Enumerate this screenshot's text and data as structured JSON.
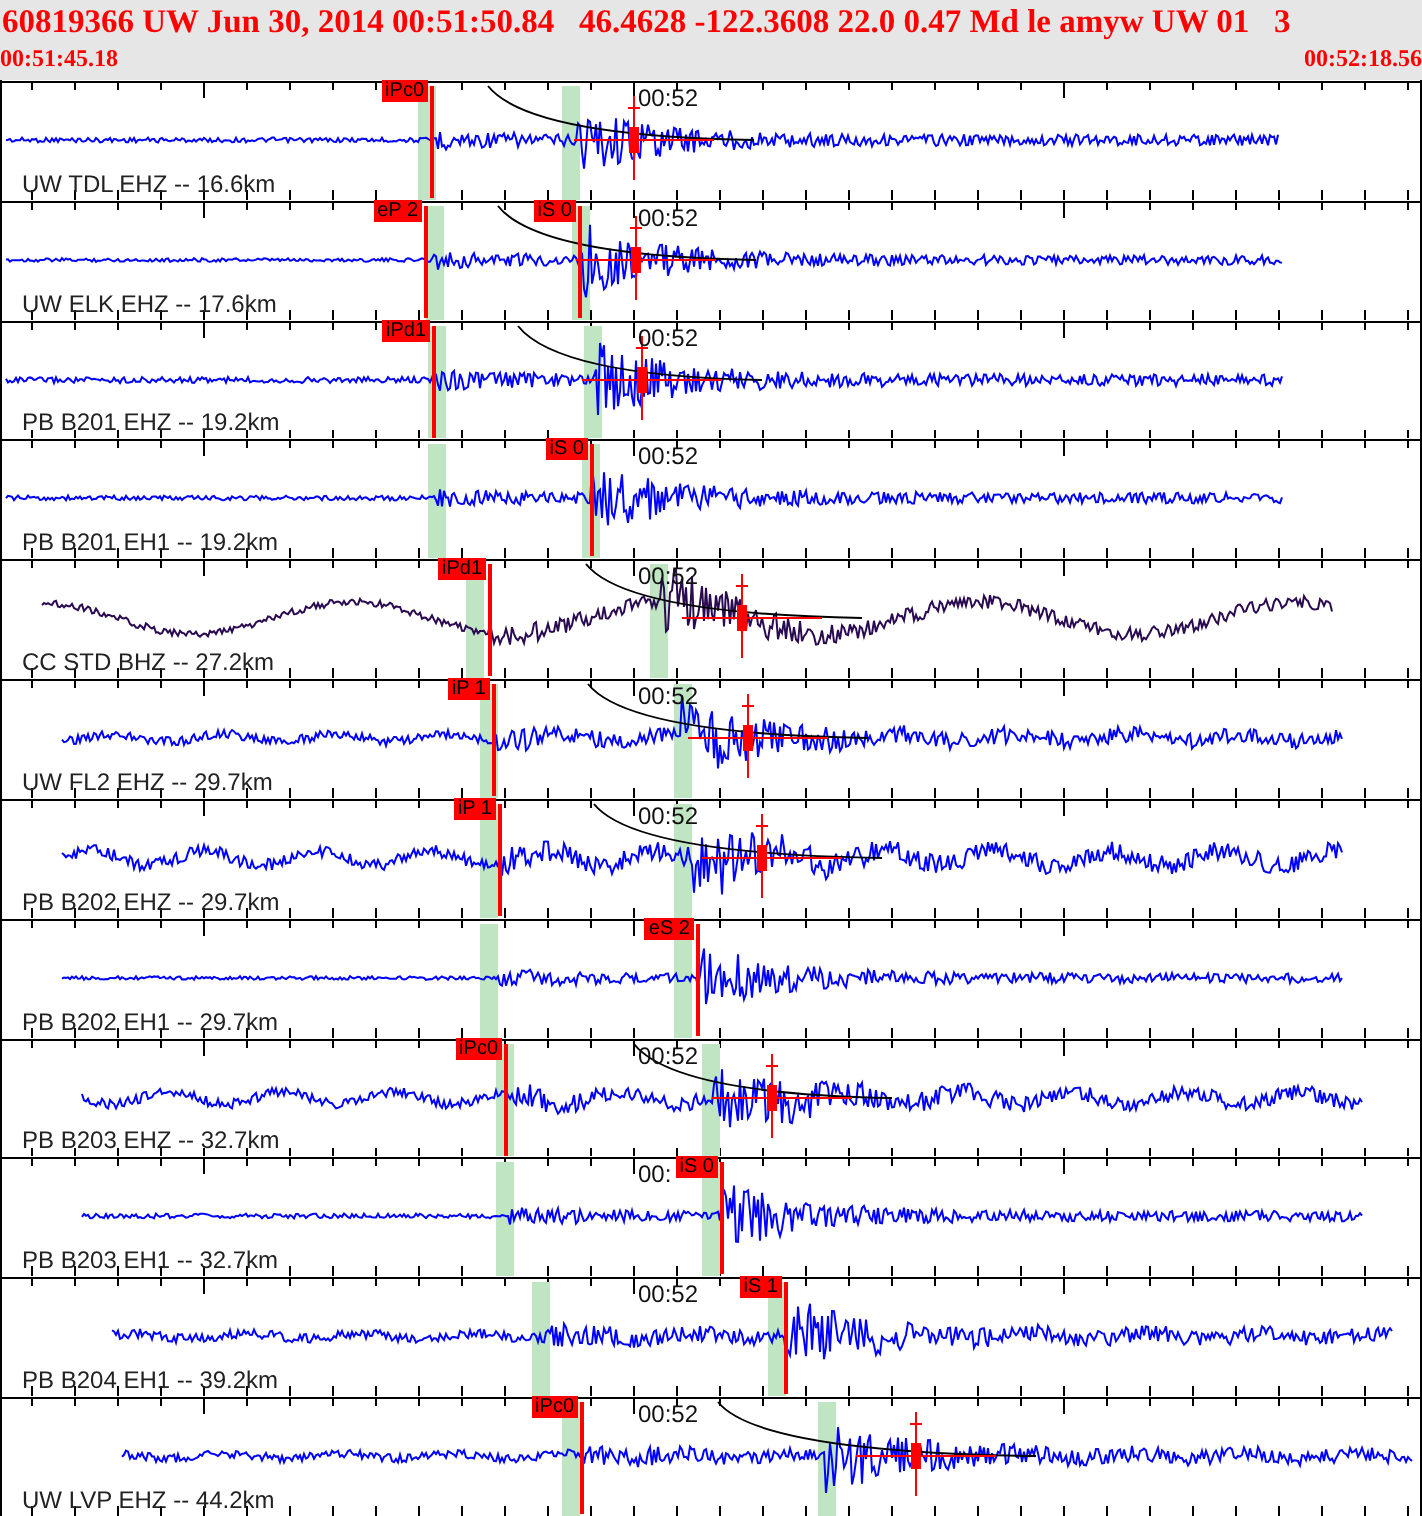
{
  "header": {
    "title": "60819366 UW Jun 30, 2014 00:51:50.84   46.4628 -122.3608 22.0 0.47 Md le amyw UW 01   3",
    "start_time": "00:51:45.18",
    "end_time": "00:52:18.56"
  },
  "traces": [
    {
      "label": "UW TDL EHZ -- 16.6km",
      "color": "#0000ff",
      "time_mark": "00:52",
      "picks": [
        {
          "label": "iPc0"
        }
      ]
    },
    {
      "label": "UW ELK EHZ -- 17.6km",
      "color": "#0000ff",
      "time_mark": "00:52",
      "picks": [
        {
          "label": "eP 2"
        },
        {
          "label": "iS 0"
        }
      ]
    },
    {
      "label": "PB B201 EHZ -- 19.2km",
      "color": "#0000ff",
      "time_mark": "00:52",
      "picks": [
        {
          "label": "iPd1"
        }
      ]
    },
    {
      "label": "PB B201 EH1 -- 19.2km",
      "color": "#0000ff",
      "time_mark": "00:52",
      "picks": [
        {
          "label": "iS 0"
        }
      ]
    },
    {
      "label": "CC STD BHZ -- 27.2km",
      "color": "#2a0a50",
      "time_mark": "00:52",
      "picks": [
        {
          "label": "iPd1"
        }
      ]
    },
    {
      "label": "UW FL2 EHZ -- 29.7km",
      "color": "#0000ff",
      "time_mark": "00:52",
      "picks": [
        {
          "label": "iP 1"
        }
      ]
    },
    {
      "label": "PB B202 EHZ -- 29.7km",
      "color": "#0000ff",
      "time_mark": "00:52",
      "picks": [
        {
          "label": "iP 1"
        }
      ]
    },
    {
      "label": "PB B202 EH1 -- 29.7km",
      "color": "#0000ff",
      "picks": [
        {
          "label": "eS 2"
        }
      ]
    },
    {
      "label": "PB B203 EHZ -- 32.7km",
      "color": "#0000ff",
      "time_mark": "00:52",
      "picks": [
        {
          "label": "iPc0"
        }
      ]
    },
    {
      "label": "PB B203 EH1 -- 32.7km",
      "color": "#0000ff",
      "time_mark": "00:",
      "picks": [
        {
          "label": "iS 0"
        }
      ]
    },
    {
      "label": "PB B204 EH1 -- 39.2km",
      "color": "#0000ff",
      "time_mark": "00:52",
      "picks": [
        {
          "label": "iS 1"
        }
      ]
    },
    {
      "label": "UW LVP EHZ -- 44.2km",
      "color": "#0000ff",
      "time_mark": "00:52",
      "picks": [
        {
          "label": "iPc0"
        }
      ]
    }
  ]
}
